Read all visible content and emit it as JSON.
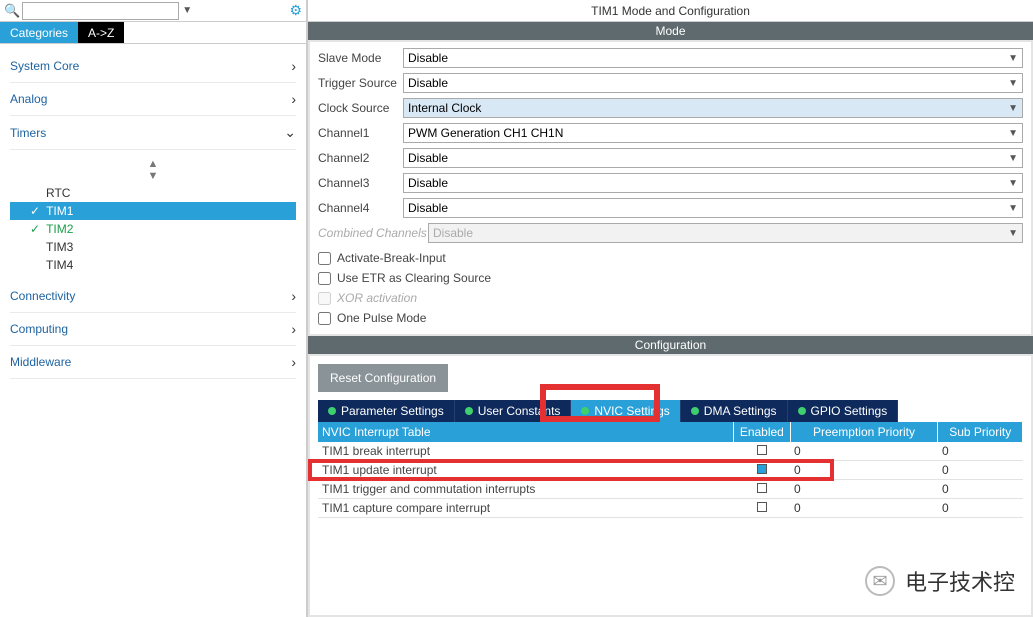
{
  "title": "TIM1 Mode and Configuration",
  "left": {
    "search_placeholder": "",
    "tabs": {
      "categories": "Categories",
      "az": "A->Z"
    },
    "sections": {
      "system_core": "System Core",
      "analog": "Analog",
      "timers": "Timers",
      "connectivity": "Connectivity",
      "computing": "Computing",
      "middleware": "Middleware"
    },
    "timer_items": {
      "rtc": "RTC",
      "tim1": "TIM1",
      "tim2": "TIM2",
      "tim3": "TIM3",
      "tim4": "TIM4"
    }
  },
  "mode": {
    "header": "Mode",
    "rows": {
      "slave_mode": {
        "label": "Slave Mode",
        "value": "Disable"
      },
      "trigger_source": {
        "label": "Trigger Source",
        "value": "Disable"
      },
      "clock_source": {
        "label": "Clock Source",
        "value": "Internal Clock"
      },
      "channel1": {
        "label": "Channel1",
        "value": "PWM Generation CH1 CH1N"
      },
      "channel2": {
        "label": "Channel2",
        "value": "Disable"
      },
      "channel3": {
        "label": "Channel3",
        "value": "Disable"
      },
      "channel4": {
        "label": "Channel4",
        "value": "Disable"
      },
      "combined": {
        "label": "Combined Channels",
        "value": "Disable"
      }
    },
    "checks": {
      "activate_break": "Activate-Break-Input",
      "use_etr": "Use ETR as Clearing Source",
      "xor": "XOR activation",
      "one_pulse": "One Pulse Mode"
    }
  },
  "config": {
    "header": "Configuration",
    "reset": "Reset Configuration",
    "tabs": {
      "parameter": "Parameter Settings",
      "user": "User Constants",
      "nvic": "NVIC Settings",
      "dma": "DMA Settings",
      "gpio": "GPIO Settings"
    },
    "nvic_table": {
      "headers": {
        "name": "NVIC Interrupt Table",
        "enabled": "Enabled",
        "preempt": "Preemption Priority",
        "sub": "Sub Priority"
      },
      "rows": [
        {
          "name": "TIM1 break interrupt",
          "enabled": false,
          "preempt": "0",
          "sub": "0"
        },
        {
          "name": "TIM1 update interrupt",
          "enabled": true,
          "preempt": "0",
          "sub": "0"
        },
        {
          "name": "TIM1 trigger and commutation interrupts",
          "enabled": false,
          "preempt": "0",
          "sub": "0"
        },
        {
          "name": "TIM1 capture compare interrupt",
          "enabled": false,
          "preempt": "0",
          "sub": "0"
        }
      ]
    }
  },
  "watermark": "电子技术控"
}
